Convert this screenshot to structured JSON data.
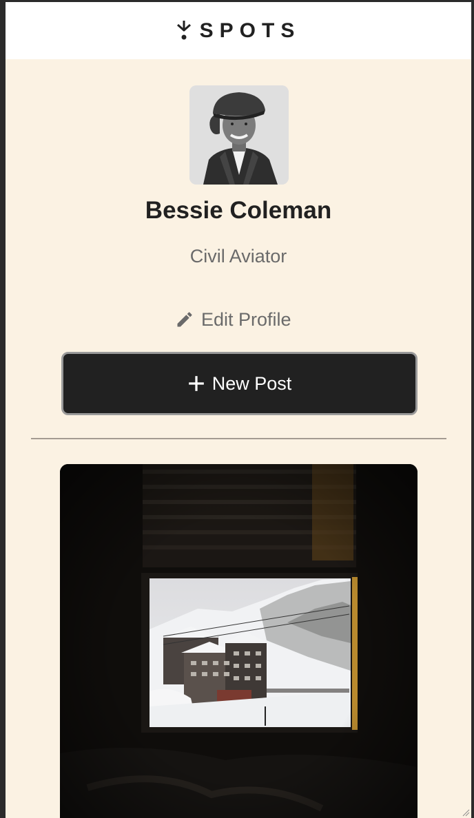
{
  "header": {
    "logo_text": "SPOTS",
    "logo_icon": "spots-logo-mark"
  },
  "profile": {
    "name": "Bessie Coleman",
    "role": "Civil Aviator",
    "avatar_icon": "profile-avatar",
    "edit_label": "Edit Profile",
    "edit_icon": "pencil-icon"
  },
  "actions": {
    "new_post_label": "New Post",
    "new_post_icon": "plus-icon"
  },
  "posts": [
    {
      "image": "mountain-lodge-through-window"
    }
  ],
  "colors": {
    "background": "#fbf2e3",
    "header_bg": "#ffffff",
    "text_dark": "#212121",
    "text_muted": "#6a6a6a",
    "button_bg": "#212121",
    "button_text": "#ffffff"
  }
}
